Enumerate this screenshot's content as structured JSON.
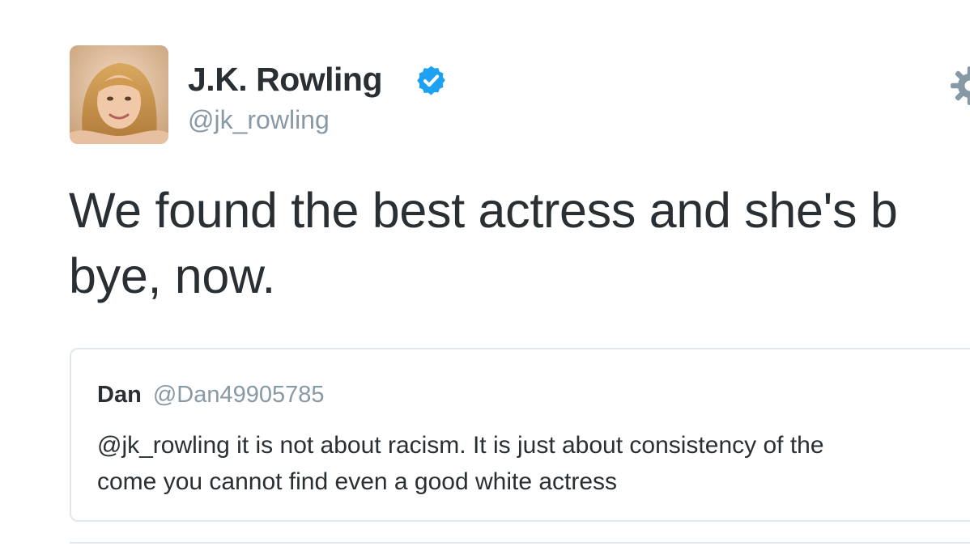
{
  "author": {
    "display_name": "J.K. Rowling",
    "handle": "@jk_rowling",
    "verified": true,
    "avatar_icon": "profile-photo"
  },
  "tweet": {
    "text_lines": [
      "We found the best actress and she's b",
      "bye, now."
    ]
  },
  "quoted_tweet": {
    "name": "Dan",
    "handle": "@Dan49905785",
    "text_lines": [
      "@jk_rowling it is not about racism. It is just about consistency of the",
      "come you cannot find even a good white actress"
    ]
  },
  "icons": {
    "verified": "verified-badge-icon",
    "settings": "gear-icon"
  },
  "colors": {
    "text": "#292f33",
    "muted": "#8899a6",
    "verified_blue": "#1da1f2",
    "border": "#e1e8ed"
  }
}
